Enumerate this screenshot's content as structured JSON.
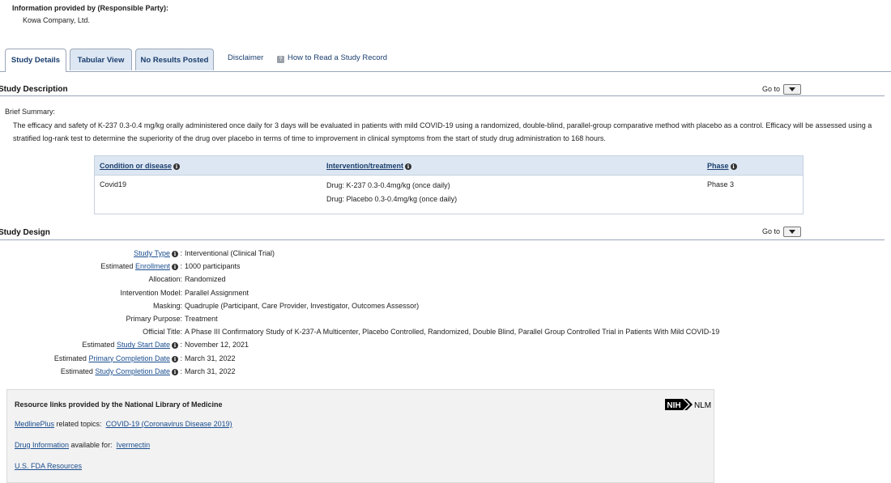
{
  "responsible_party": {
    "label": "Information provided by (Responsible Party):",
    "value": "Kowa Company, Ltd."
  },
  "tabs": {
    "study_details": "Study Details",
    "tabular_view": "Tabular View",
    "no_results": "No Results Posted",
    "disclaimer": "Disclaimer",
    "how_to_read": "How to Read a Study Record"
  },
  "goto_label": "Go to",
  "study_description": {
    "title": "Study Description",
    "brief_label": "Brief Summary:",
    "brief_text": "The efficacy and safety of K-237 0.3-0.4 mg/kg orally administered once daily for 3 days will be evaluated in patients with mild COVID-19 using a randomized, double-blind, parallel-group comparative method with placebo as a control. Efficacy will be assessed using a stratified log-rank test to determine the superiority of the drug over placebo in terms of time to improvement in clinical symptoms from the start of study drug administration to 168 hours."
  },
  "condition_table": {
    "headers": {
      "condition": "Condition or disease",
      "intervention": "Intervention/treatment",
      "phase": "Phase"
    },
    "condition": "Covid19",
    "interventions": [
      "Drug: K-237 0.3-0.4mg/kg (once daily)",
      "Drug: Placebo 0.3-0.4mg/kg (once daily)"
    ],
    "phase": "Phase 3"
  },
  "study_design": {
    "title": "Study Design",
    "rows": [
      {
        "prefix": "",
        "link": "Study Type",
        "info": true,
        "label": "",
        "value": "Interventional  (Clinical Trial)"
      },
      {
        "prefix": "Estimated ",
        "link": "Enrollment",
        "info": true,
        "label": "",
        "value": "1000 participants"
      },
      {
        "prefix": "",
        "link": "",
        "info": false,
        "label": "Allocation:",
        "value": "Randomized"
      },
      {
        "prefix": "",
        "link": "",
        "info": false,
        "label": "Intervention Model:",
        "value": "Parallel Assignment"
      },
      {
        "prefix": "",
        "link": "",
        "info": false,
        "label": "Masking:",
        "value": "Quadruple (Participant, Care Provider, Investigator, Outcomes Assessor)"
      },
      {
        "prefix": "",
        "link": "",
        "info": false,
        "label": "Primary Purpose:",
        "value": "Treatment"
      },
      {
        "prefix": "",
        "link": "",
        "info": false,
        "label": "Official Title:",
        "value": "A Phase III Confirmatory Study of K-237-A Multicenter, Placebo Controlled, Randomized, Double Blind, Parallel Group Controlled Trial in Patients With Mild COVID-19"
      },
      {
        "prefix": "Estimated ",
        "link": "Study Start Date",
        "info": true,
        "label": "",
        "value": "November 12, 2021"
      },
      {
        "prefix": "Estimated ",
        "link": "Primary Completion Date",
        "info": true,
        "label": "",
        "value": "March 31, 2022"
      },
      {
        "prefix": "Estimated ",
        "link": "Study Completion Date",
        "info": true,
        "label": "",
        "value": "March 31, 2022"
      }
    ]
  },
  "resources": {
    "title": "Resource links provided by the National Library of Medicine",
    "logo_nih": "NIH",
    "logo_nlm": "NLM",
    "medlineplus_link": "MedlinePlus",
    "medlineplus_text": " related topics:",
    "medlineplus_topic": "COVID-19 (Coronavirus Disease 2019)",
    "drug_info_link": "Drug Information",
    "drug_info_text": " available for:",
    "drug_info_drug": "Ivermectin",
    "fda_link": "U.S. FDA Resources"
  }
}
